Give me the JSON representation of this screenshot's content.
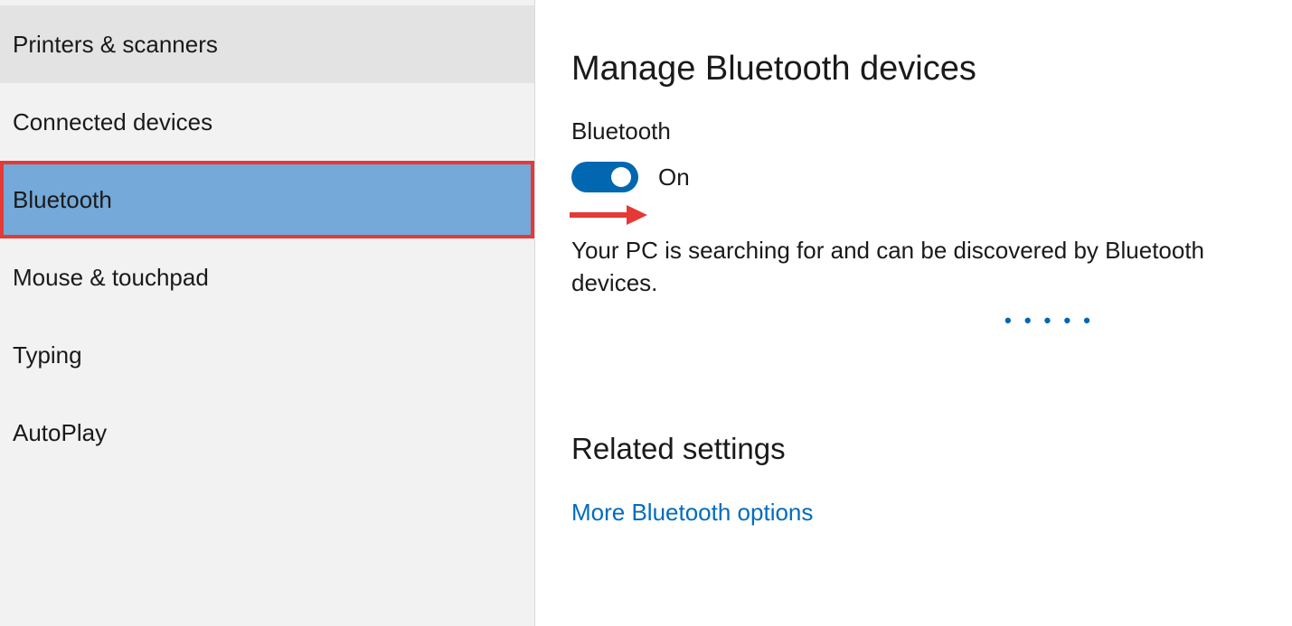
{
  "sidebar": {
    "items": [
      {
        "label": "Printers & scanners"
      },
      {
        "label": "Connected devices"
      },
      {
        "label": "Bluetooth"
      },
      {
        "label": "Mouse & touchpad"
      },
      {
        "label": "Typing"
      },
      {
        "label": "AutoPlay"
      }
    ]
  },
  "main": {
    "title": "Manage Bluetooth devices",
    "toggle_label": "Bluetooth",
    "toggle_state": "On",
    "status_text": "Your PC is searching for and can be discovered by Bluetooth devices.",
    "related_heading": "Related settings",
    "more_link": "More Bluetooth options"
  }
}
